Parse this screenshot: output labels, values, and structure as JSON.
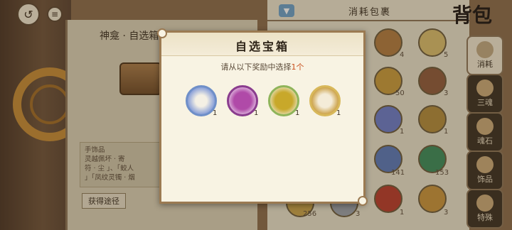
{
  "top_bar": {
    "back_icon": "back-icon",
    "menu_icon": "menu-icon"
  },
  "left_panel": {
    "title": "神龛 · 自选箱",
    "description_lines": [
      "手饰品",
      "灵越佩坏 · 寄",
      "符 · 尘 」、「蛟人",
      "」「凤纹灵镯 · 烟"
    ],
    "obtain_button": "获得途径"
  },
  "right_panel": {
    "header": "消耗包裹",
    "bag_title": "背包",
    "grid_counts": [
      "4",
      "5",
      "50",
      "3",
      "1",
      "1",
      "141",
      "153",
      "1",
      "3",
      "256",
      "3"
    ],
    "tabs": [
      "消耗",
      "三魂",
      "魂石",
      "饰品",
      "特殊"
    ]
  },
  "modal": {
    "title": "自选宝箱",
    "prompt_prefix": "请从以下奖励中选择",
    "prompt_count": "1个",
    "rewards": [
      {
        "icon": "ring-mirror-icon",
        "count": "1",
        "color": "#6f8fc8"
      },
      {
        "icon": "purple-pouch-icon",
        "count": "1",
        "color": "#8a3c8e"
      },
      {
        "icon": "gold-pouch-icon",
        "count": "1",
        "color": "#b79a2a"
      },
      {
        "icon": "gold-bracelet-icon",
        "count": "1",
        "color": "#c89a3a"
      }
    ]
  },
  "colors": {
    "accent": "#c8501e",
    "frame": "#9b7a52"
  }
}
